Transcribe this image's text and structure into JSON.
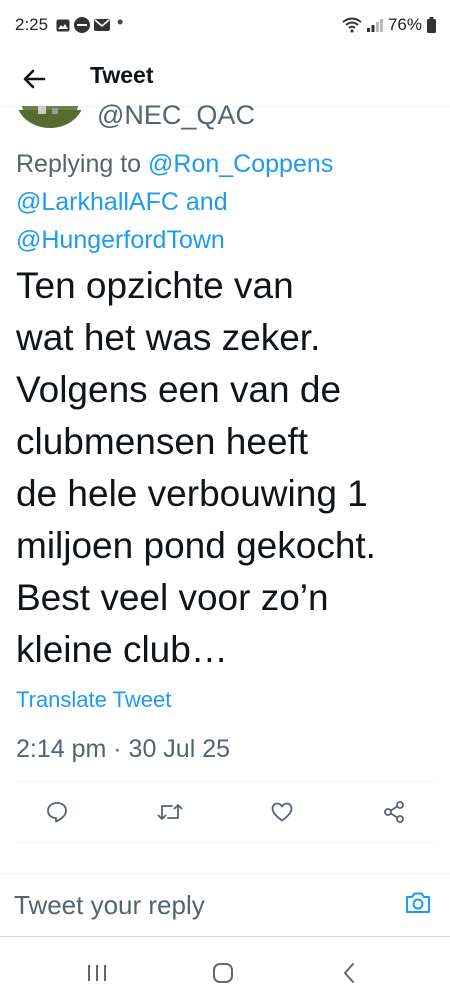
{
  "status_bar": {
    "time": "2:25",
    "battery": "76%"
  },
  "header": {
    "title": "Tweet"
  },
  "tweet": {
    "handle": "@NEC_QAC",
    "replying_prefix": "Replying to",
    "replying_to": [
      "@Ron_Coppens",
      "@LarkhallAFC",
      "@HungerfordTown"
    ],
    "replying_and": "and",
    "text": "Ten opzichte van\nwat het was zeker.\nVolgens een van de\nclubmensen heeft\nde hele verbouwing 1\nmiljoen pond gekocht.\nBest veel voor zo’n\nkleine club…",
    "translate_label": "Translate Tweet",
    "timestamp": "2:14 pm · 30 Jul 25"
  },
  "actions": [
    "reply-icon",
    "retweet-icon",
    "like-icon",
    "share-icon"
  ],
  "reply_bar": {
    "placeholder": "Tweet your reply"
  },
  "colors": {
    "accent": "#1d9bf0",
    "secondary_text": "#536471",
    "primary_text": "#0f1419"
  }
}
